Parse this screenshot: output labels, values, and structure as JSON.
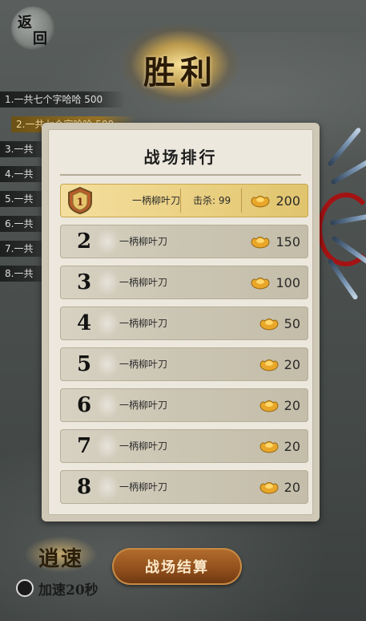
{
  "back_button": {
    "chars": [
      "返",
      "回"
    ]
  },
  "victory_title": "胜利",
  "notifications": [
    "1.一共七个字哈哈 500",
    "2.一共七个字哈哈 500",
    "3.一共",
    "4.一共",
    "5.一共",
    "6.一共",
    "7.一共",
    "8.一共"
  ],
  "panel": {
    "title": "战场排行",
    "rows": [
      {
        "rank": "1",
        "name": "一柄柳叶刀",
        "kills_label": "击杀:",
        "kills": "99",
        "reward": "200"
      },
      {
        "rank": "2",
        "name": "一柄柳叶刀",
        "reward": "150"
      },
      {
        "rank": "3",
        "name": "一柄柳叶刀",
        "reward": "100"
      },
      {
        "rank": "4",
        "name": "一柄柳叶刀",
        "reward": "50"
      },
      {
        "rank": "5",
        "name": "一柄柳叶刀",
        "reward": "20"
      },
      {
        "rank": "6",
        "name": "一柄柳叶刀",
        "reward": "20"
      },
      {
        "rank": "7",
        "name": "一柄柳叶刀",
        "reward": "20"
      },
      {
        "rank": "8",
        "name": "一柄柳叶刀",
        "reward": "20"
      }
    ]
  },
  "speed_badge": "逍速",
  "speed_tip": "加速20秒",
  "settle_button": "战场结算",
  "colors": {
    "gold": "#e9cf80",
    "button": "#8f4e1c",
    "panel": "#ece8dd"
  }
}
